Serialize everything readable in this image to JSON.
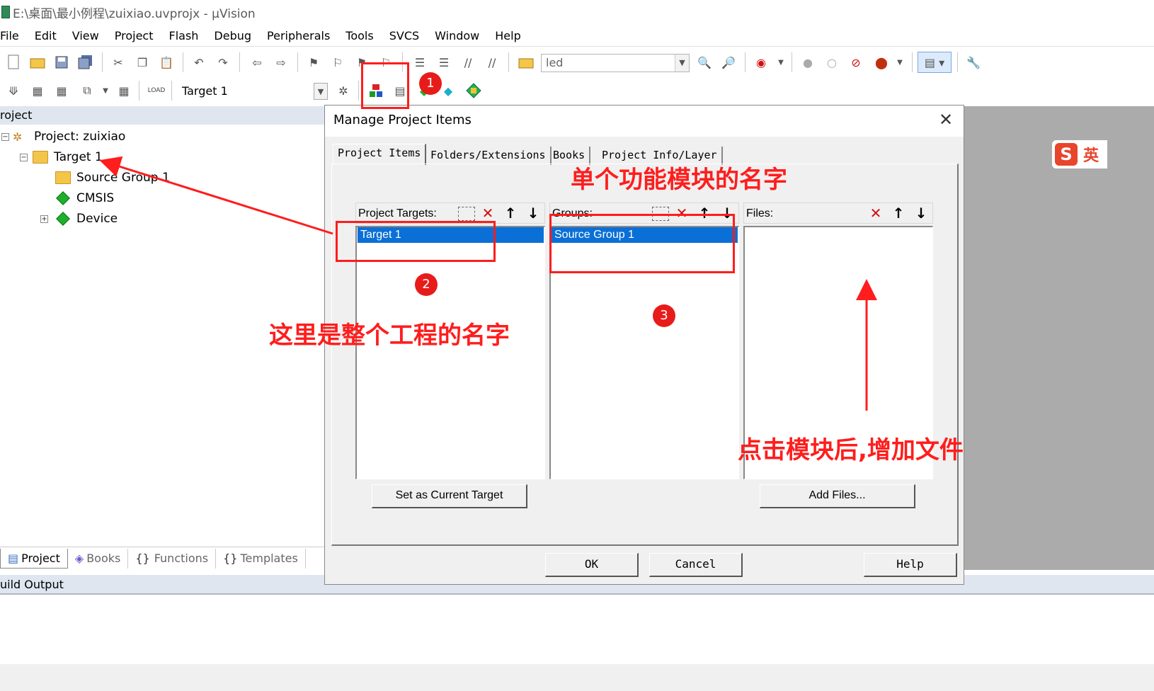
{
  "window": {
    "title": "E:\\桌面\\最小例程\\zuixiao.uvprojx - µVision"
  },
  "menu": [
    "File",
    "Edit",
    "View",
    "Project",
    "Flash",
    "Debug",
    "Peripherals",
    "Tools",
    "SVCS",
    "Window",
    "Help"
  ],
  "toolbar1": {
    "find_value": "led"
  },
  "toolbar2": {
    "target_select": "Target 1"
  },
  "project_panel": {
    "header": "roject",
    "tree": {
      "project": "Project: zuixiao",
      "target": "Target 1",
      "group": "Source Group 1",
      "cmsis": "CMSIS",
      "device": "Device"
    },
    "tabs": [
      "Project",
      "Books",
      "Functions",
      "Templates"
    ]
  },
  "build_output": {
    "header": "uild Output"
  },
  "ime": {
    "lang": "英"
  },
  "dialog": {
    "title": "Manage Project Items",
    "tabs": [
      "Project Items",
      "Folders/Extensions",
      "Books",
      "Project Info/Layer"
    ],
    "targets": {
      "label": "Project Targets:",
      "items": [
        "Target 1"
      ],
      "button": "Set as Current Target"
    },
    "groups": {
      "label": "Groups:",
      "items": [
        "Source Group 1"
      ]
    },
    "files": {
      "label": "Files:",
      "button": "Add Files..."
    },
    "buttons": {
      "ok": "OK",
      "cancel": "Cancel",
      "help": "Help"
    }
  },
  "annotations": {
    "badge1": "1",
    "badge2": "2",
    "badge3": "3",
    "project_name": "这里是整个工程的名字",
    "module_name": "单个功能模块的名字",
    "add_files": "点击模块后,增加文件"
  },
  "colors": {
    "annotation_red": "#ff1d1d",
    "selection_blue": "#0a6fd6"
  }
}
